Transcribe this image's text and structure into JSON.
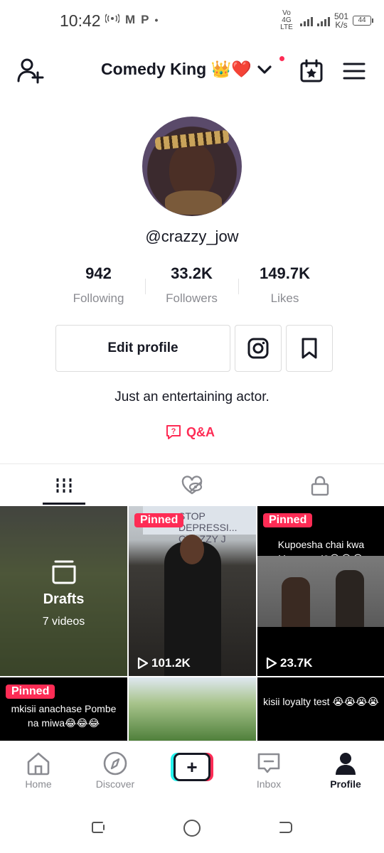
{
  "status_bar": {
    "time": "10:42",
    "notif_icons": [
      "hotspot-icon",
      "gmail-icon",
      "p-icon",
      "dot"
    ],
    "m_glyph": "M",
    "p_glyph": "P",
    "network": "Vo 4G LTE",
    "speed_value": "501",
    "speed_unit": "K/s",
    "battery": "44"
  },
  "header": {
    "title": "Comedy King 👑❤️",
    "colors": {
      "notification_dot": "#fe2c55"
    }
  },
  "profile": {
    "username": "@crazzy_jow",
    "stats": [
      {
        "value": "942",
        "label": "Following"
      },
      {
        "value": "33.2K",
        "label": "Followers"
      },
      {
        "value": "149.7K",
        "label": "Likes"
      }
    ],
    "edit_label": "Edit profile",
    "bio": "Just an entertaining actor.",
    "qa_label": "Q&A"
  },
  "tabs": [
    "videos-grid-icon",
    "liked-hidden-icon",
    "private-lock-icon"
  ],
  "grid": {
    "drafts": {
      "title": "Drafts",
      "count": "7 videos"
    },
    "pinned_label": "Pinned",
    "items": [
      {
        "pinned": true,
        "views": "101.2K",
        "caption": "",
        "sign": "STOP DEPRESSI... CRAZZY J"
      },
      {
        "pinned": true,
        "views": "23.7K",
        "caption": "Kupoesha chai kwa kizungu ni?😂😂😂"
      },
      {
        "pinned": true,
        "views": "",
        "caption": "mkisii anachase Pombe na miwa😂😂😂"
      },
      {
        "pinned": false,
        "views": "",
        "caption": ""
      },
      {
        "pinned": false,
        "views": "",
        "caption": "kisii loyalty test 😭😭😭😭"
      }
    ]
  },
  "bottom_nav": {
    "items": [
      {
        "label": "Home"
      },
      {
        "label": "Discover"
      },
      {
        "label": ""
      },
      {
        "label": "Inbox"
      },
      {
        "label": "Profile"
      }
    ]
  },
  "colors": {
    "accent": "#fe2c55",
    "cyan": "#25f4ee",
    "text": "#161823",
    "muted": "#8a8b91"
  }
}
